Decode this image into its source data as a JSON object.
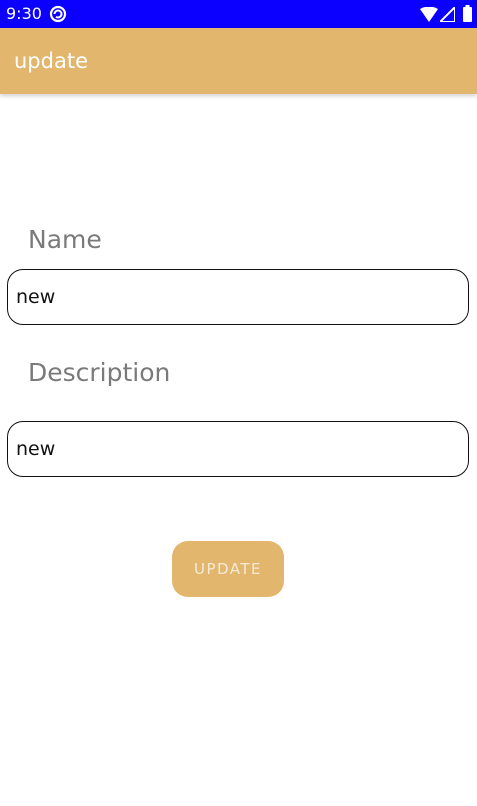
{
  "status_bar": {
    "time": "9:30",
    "icons": [
      "sync-icon",
      "wifi-icon",
      "signal-icon",
      "battery-icon"
    ],
    "background_color": "#0b00ff"
  },
  "app_bar": {
    "title": "update",
    "background_color": "#e2b76d"
  },
  "form": {
    "name_label": "Name",
    "name_value": "new",
    "description_label": "Description",
    "description_value": "new",
    "update_button_label": "UPDATE"
  }
}
